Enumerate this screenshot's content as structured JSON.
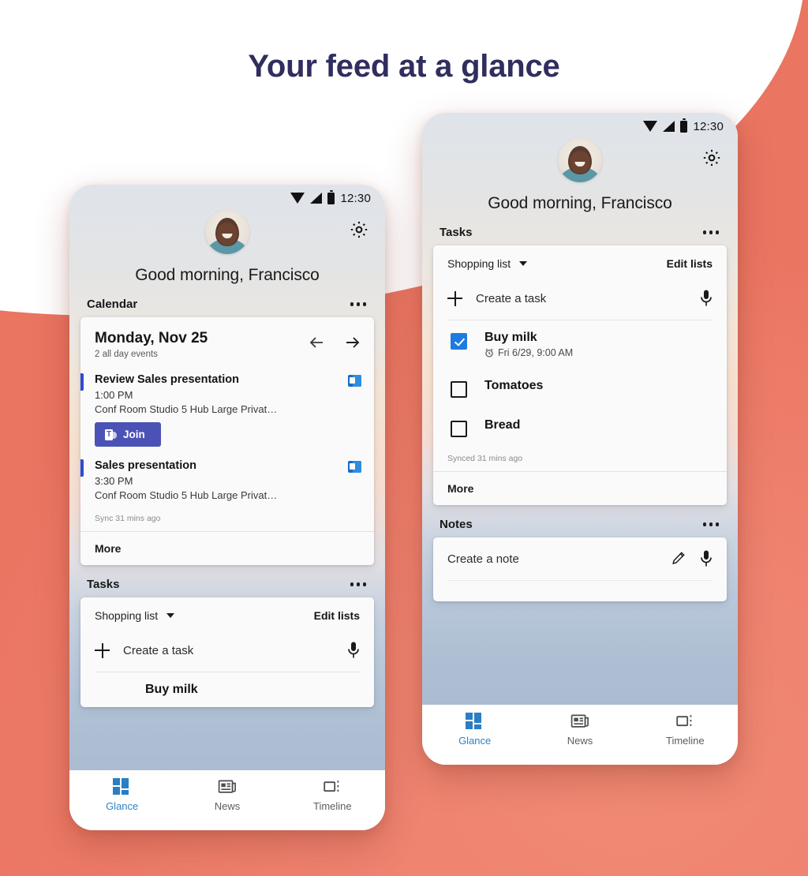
{
  "page": {
    "headline": "Your feed at a glance",
    "headline_color": "#2f2e5e",
    "background_color": "#ef8370",
    "panel_color": "#ffffff"
  },
  "status_bar": {
    "time": "12:30",
    "icons": [
      "wifi-icon",
      "cellular-signal-icon",
      "battery-icon"
    ]
  },
  "header": {
    "greeting": "Good morning, Francisco",
    "avatar_name": "avatar",
    "settings_icon": "gear-icon"
  },
  "calendar_section": {
    "title": "Calendar",
    "overflow_icon": "more-options-icon",
    "date": "Monday, Nov 25",
    "subtitle": "2 all day events",
    "prev_icon": "arrow-left-icon",
    "next_icon": "arrow-right-icon",
    "events": [
      {
        "title": "Review Sales presentation",
        "time": "1:00 PM",
        "location": "Conf Room Studio 5 Hub Large Privat…",
        "source_icon": "outlook-icon",
        "join_label": "Join",
        "join_icon": "teams-icon",
        "accent": "#2d4bd2"
      },
      {
        "title": "Sales presentation",
        "time": "3:30 PM",
        "location": "Conf Room Studio 5 Hub Large Privat…",
        "source_icon": "outlook-icon",
        "accent": "#2d4bd2"
      }
    ],
    "sync_note": "Sync 31 mins ago",
    "more_label": "More"
  },
  "tasks_section": {
    "title": "Tasks",
    "overflow_icon": "more-options-icon",
    "list_name": "Shopping list",
    "list_caret_icon": "chevron-down-icon",
    "edit_lists_label": "Edit lists",
    "create_label": "Create a task",
    "create_icon": "plus-icon",
    "mic_icon": "microphone-icon",
    "items": [
      {
        "title": "Buy milk",
        "due": "Fri 6/29, 9:00 AM",
        "due_icon": "alarm-clock-icon",
        "checked": true
      },
      {
        "title": "Tomatoes",
        "due": "",
        "checked": false
      },
      {
        "title": "Bread",
        "due": "",
        "checked": false
      }
    ],
    "sync_note": "Synced 31 mins ago",
    "more_label": "More",
    "checkbox_color": "#1e7ae0"
  },
  "notes_section": {
    "title": "Notes",
    "overflow_icon": "more-options-icon",
    "create_label": "Create a note",
    "pencil_icon": "pencil-icon",
    "mic_icon": "microphone-icon"
  },
  "bottom_nav": {
    "active": "Glance",
    "active_color": "#3182c4",
    "items": [
      {
        "label": "Glance",
        "icon": "glance-grid-icon"
      },
      {
        "label": "News",
        "icon": "news-paper-icon"
      },
      {
        "label": "Timeline",
        "icon": "timeline-icon"
      }
    ]
  },
  "left_phone_cutoff_task": "Buy milk"
}
